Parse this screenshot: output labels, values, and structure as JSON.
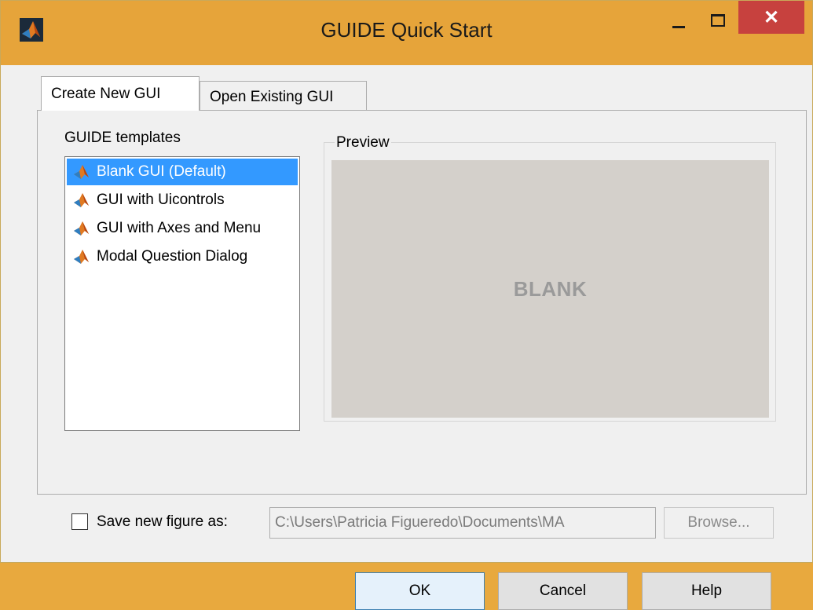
{
  "window": {
    "title": "GUIDE Quick Start",
    "close_glyph": "✕"
  },
  "tabs": [
    {
      "label": "Create New GUI",
      "active": true
    },
    {
      "label": "Open Existing GUI",
      "active": false
    }
  ],
  "templates": {
    "label": "GUIDE templates",
    "items": [
      {
        "label": "Blank GUI (Default)",
        "selected": true,
        "icon": "matlab-icon"
      },
      {
        "label": "GUI with Uicontrols",
        "selected": false,
        "icon": "matlab-icon"
      },
      {
        "label": "GUI with Axes and Menu",
        "selected": false,
        "icon": "matlab-icon"
      },
      {
        "label": "Modal Question Dialog",
        "selected": false,
        "icon": "matlab-icon"
      }
    ]
  },
  "preview": {
    "label": "Preview",
    "text": "BLANK"
  },
  "save": {
    "checkbox_label": "Save new figure as:",
    "checked": false,
    "path_value": "C:\\Users\\Patricia Figueredo\\Documents\\MA",
    "browse_label": "Browse..."
  },
  "buttons": {
    "ok": "OK",
    "cancel": "Cancel",
    "help": "Help"
  },
  "colors": {
    "titlebar": "#e6a43a",
    "close": "#c7413e",
    "selection": "#3399ff"
  }
}
